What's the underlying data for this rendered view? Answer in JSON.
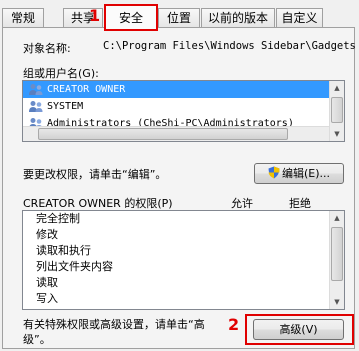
{
  "tabs": [
    {
      "label": "常规"
    },
    {
      "label": "共享"
    },
    {
      "label": "安全",
      "selected": true
    },
    {
      "label": "位置"
    },
    {
      "label": "以前的版本"
    },
    {
      "label": "自定义"
    }
  ],
  "annotations": {
    "step1": "1",
    "step2": "2",
    "color": "#e00000"
  },
  "object_name": {
    "label": "对象名称:",
    "value": "C:\\Program Files\\Windows Sidebar\\Gadgets"
  },
  "groups": {
    "label": "组或用户名(G):",
    "items": [
      {
        "name": "CREATOR OWNER",
        "icon": "users-icon",
        "selected": true
      },
      {
        "name": "SYSTEM",
        "icon": "users-icon"
      },
      {
        "name": "Administrators (CheShi-PC\\Administrators)",
        "icon": "users-icon"
      }
    ]
  },
  "edit": {
    "hint": "要更改权限，请单击“编辑”。",
    "button_label": "编辑(E)..."
  },
  "permissions": {
    "title": "CREATOR OWNER 的权限(P)",
    "allow_header": "允许",
    "deny_header": "拒绝",
    "items": [
      "完全控制",
      "修改",
      "读取和执行",
      "列出文件夹内容",
      "读取",
      "写入"
    ]
  },
  "advanced": {
    "hint_line1": "有关特殊权限或高级设置，请单击“高",
    "hint_line2": "级”。",
    "button_label": "高级(V)"
  },
  "colors": {
    "selection": "#3399ff",
    "panel": "#f4f4f4",
    "highlight": "#e00000"
  }
}
